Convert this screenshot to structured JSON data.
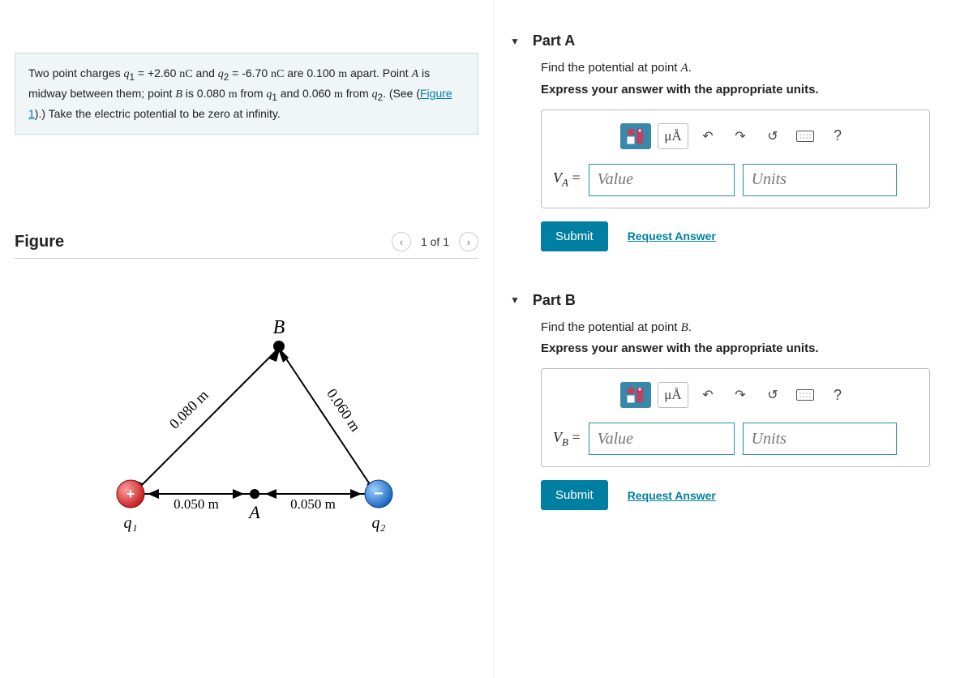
{
  "problem": {
    "html_parts": [
      "Two point charges ",
      "q",
      "1",
      " = +2.60 ",
      "nC",
      " and ",
      "q",
      "2",
      " = -6.70 ",
      "nC",
      " are 0.100 ",
      "m",
      " apart. Point ",
      "A",
      " is midway between them; point ",
      "B",
      " is 0.080 ",
      "m",
      " from ",
      "q",
      "1",
      " and 0.060 ",
      "m",
      " from ",
      "q",
      "2",
      ". (See (",
      "Figure 1",
      ").) Take the electric potential to be zero at infinity."
    ]
  },
  "figure": {
    "title": "Figure",
    "counter": "1 of 1",
    "labels": {
      "B": "B",
      "A": "A",
      "q1": "q₁",
      "q2": "q₂",
      "left_side": "0.080 m",
      "right_side": "0.060 m",
      "bottom_left": "0.050 m",
      "bottom_right": "0.050 m"
    }
  },
  "partA": {
    "title": "Part A",
    "instruction_prefix": "Find the potential at point ",
    "instruction_point": "A",
    "instruction_suffix": ".",
    "units_instruction": "Express your answer with the appropriate units.",
    "var_label": "V",
    "var_sub": "A",
    "equals": " =",
    "value_placeholder": "Value",
    "units_placeholder": "Units",
    "toolbar_mu": "μÅ",
    "submit": "Submit",
    "request": "Request Answer"
  },
  "partB": {
    "title": "Part B",
    "instruction_prefix": "Find the potential at point ",
    "instruction_point": "B",
    "instruction_suffix": ".",
    "units_instruction": "Express your answer with the appropriate units.",
    "var_label": "V",
    "var_sub": "B",
    "equals": " =",
    "value_placeholder": "Value",
    "units_placeholder": "Units",
    "toolbar_mu": "μÅ",
    "submit": "Submit",
    "request": "Request Answer"
  }
}
